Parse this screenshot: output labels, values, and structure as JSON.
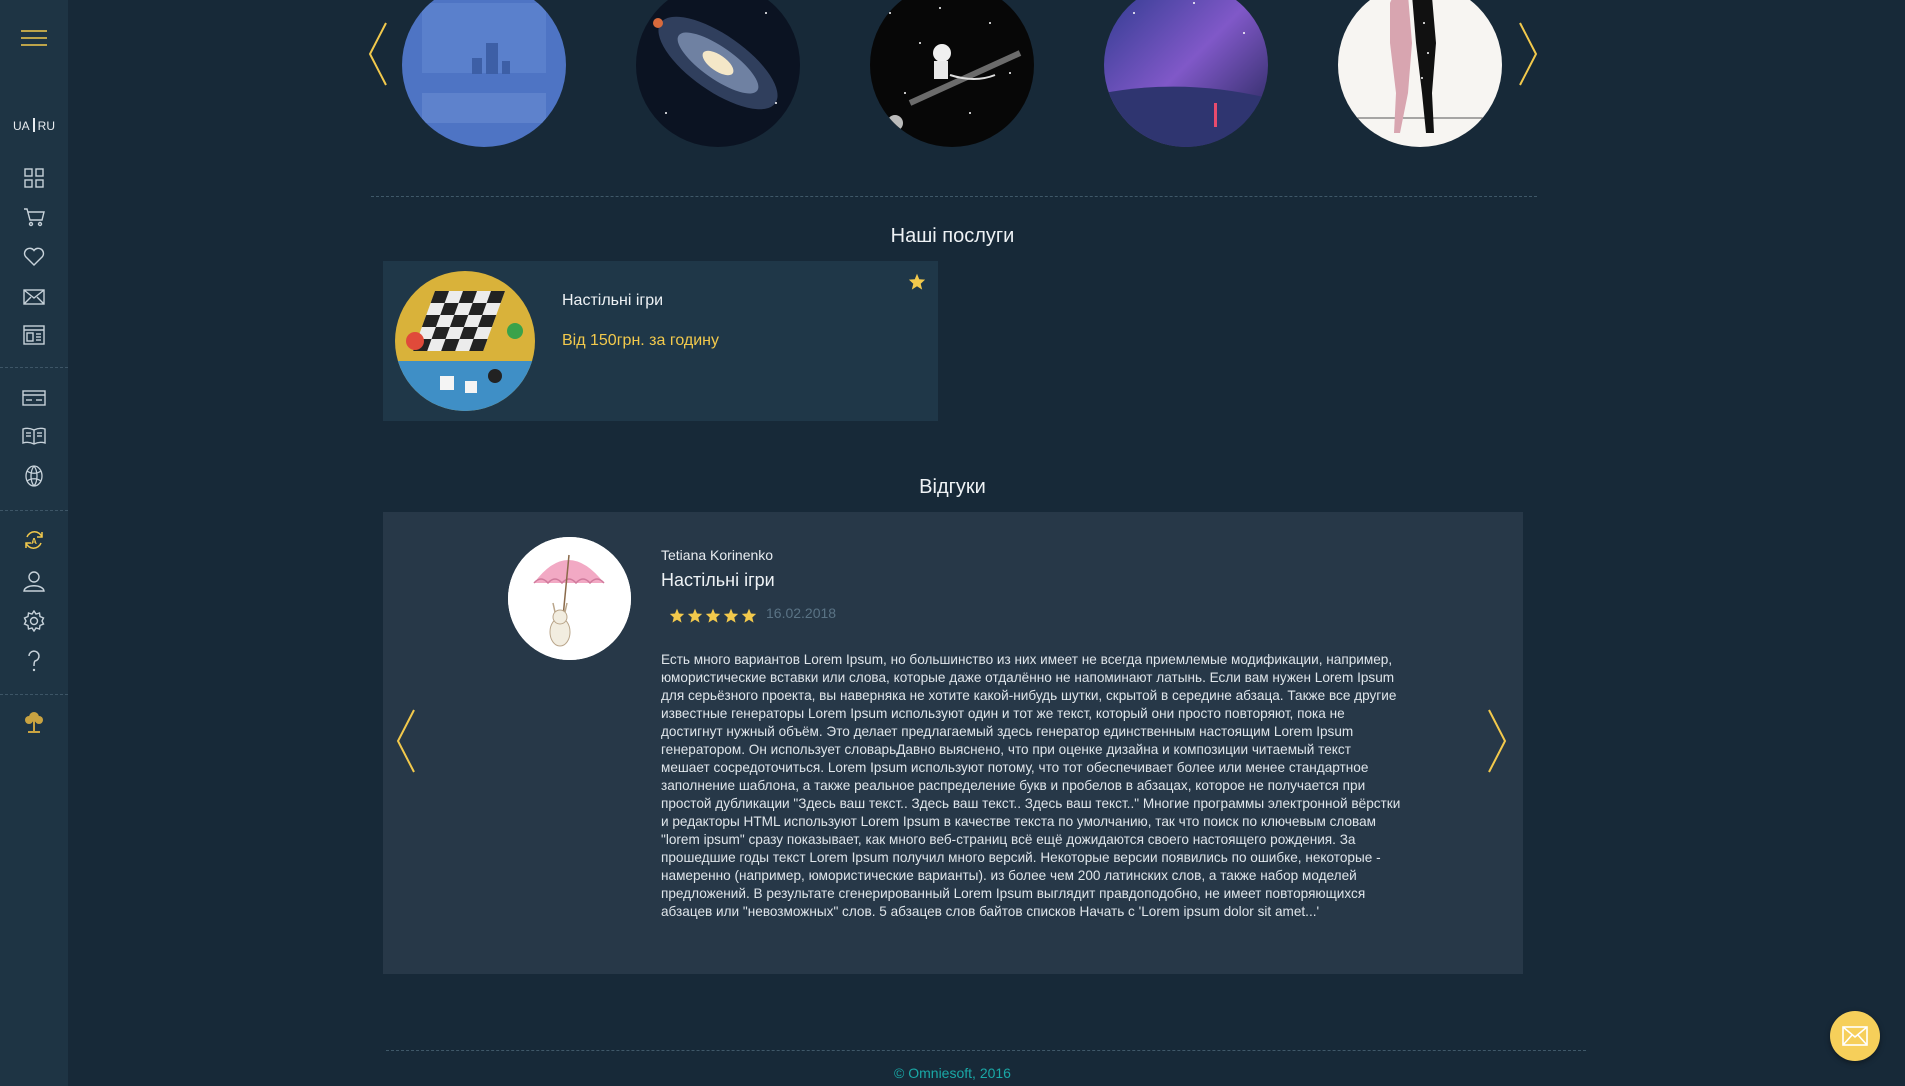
{
  "language": {
    "ua": "UA",
    "ru": "RU"
  },
  "sections": {
    "services_title": "Наші послуги",
    "reviews_title": "Відгуки"
  },
  "service": {
    "name": "Настільні ігри",
    "price": "Від 150грн. за годину"
  },
  "review": {
    "author": "Tetiana Korinenko",
    "title": "Настільні ігри",
    "rating": 5,
    "date": "16.02.2018",
    "text": "Есть много вариантов Lorem Ipsum, но большинство из них имеет не всегда приемлемые модификации, например, юмористические вставки или слова, которые даже отдалённо не напоминают латынь. Если вам нужен Lorem Ipsum для серьёзного проекта, вы наверняка не хотите какой-нибудь шутки, скрытой в середине абзаца. Также все другие известные генераторы Lorem Ipsum используют один и тот же текст, который они просто повторяют, пока не достигнут нужный объём. Это делает предлагаемый здесь генератор единственным настоящим Lorem Ipsum генератором. Он использует словарьДавно выяснено, что при оценке дизайна и композиции читаемый текст мешает сосредоточиться. Lorem Ipsum используют потому, что тот обеспечивает более или менее стандартное заполнение шаблона, а также реальное распределение букв и пробелов в абзацах, которое не получается при простой дубликации \"Здесь ваш текст.. Здесь ваш текст.. Здесь ваш текст..\" Многие программы электронной вёрстки и редакторы HTML используют Lorem Ipsum в качестве текста по умолчанию, так что поиск по ключевым словам \"lorem ipsum\" сразу показывает, как много веб-страниц всё ещё дожидаются своего настоящего рождения. За прошедшие годы текст Lorem Ipsum получил много версий. Некоторые версии появились по ошибке, некоторые - намеренно (например, юмористические варианты). из более чем 200 латинских слов, а также набор моделей предложений. В результате сгенерированный Lorem Ipsum выглядит правдоподобно, не имеет повторяющихся абзацев или \"невозможных\" слов. 5 абзацев слов байтов списков Начать с 'Lorem ipsum dolor sit amet...'"
  },
  "footer": {
    "copyright": "© Omniesoft, 2016"
  },
  "colors": {
    "background": "#172938",
    "sidebar": "#1e3444",
    "accent": "#f2c94c",
    "footer_text": "#1aa8a6"
  },
  "icons": {
    "sidebar": [
      "menu-icon",
      "grid-icon",
      "cart-icon",
      "heart-icon",
      "mail-icon",
      "news-icon",
      "card-icon",
      "book-icon",
      "ball-icon",
      "refresh-a-icon",
      "user-icon",
      "gear-icon",
      "question-icon",
      "tree-icon"
    ]
  }
}
